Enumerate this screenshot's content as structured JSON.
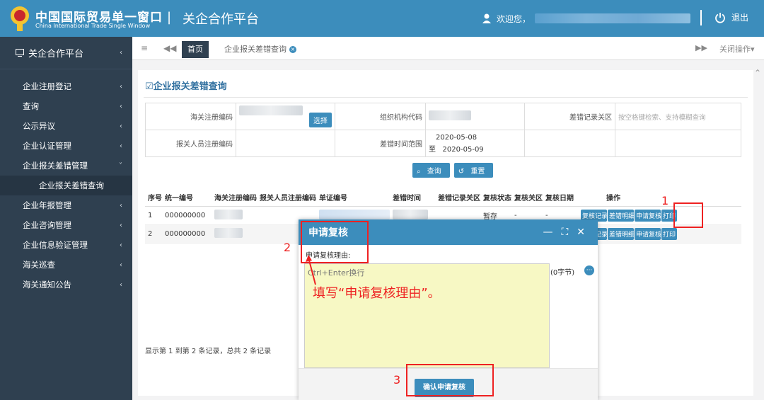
{
  "header": {
    "brand_cn": "中国国际贸易单一窗口",
    "brand_en": "China International Trade Single Window",
    "separator": "|",
    "platform": "关企合作平台",
    "welcome": "欢迎您，",
    "logout": "退出"
  },
  "sidebar": {
    "title": "关企合作平台",
    "items": [
      {
        "label": "企业注册登记",
        "chevron": "‹"
      },
      {
        "label": "查询",
        "chevron": "‹"
      },
      {
        "label": "公示异议",
        "chevron": "‹"
      },
      {
        "label": "企业认证管理",
        "chevron": "‹"
      },
      {
        "label": "企业报关差错管理",
        "chevron": "˅"
      }
    ],
    "sub_item": "企业报关差错查询",
    "items2": [
      {
        "label": "企业年报管理",
        "chevron": "‹"
      },
      {
        "label": "企业咨询管理",
        "chevron": "‹"
      },
      {
        "label": "企业信息验证管理",
        "chevron": "‹"
      },
      {
        "label": "海关巡查",
        "chevron": "‹"
      },
      {
        "label": "海关通知公告",
        "chevron": "‹"
      }
    ]
  },
  "tabs": {
    "home": "首页",
    "current": "企业报关差错查询",
    "close_ops": "关闭操作▾"
  },
  "page": {
    "title": "企业报关差错查询",
    "search": {
      "customs_code_label": "海关注册编码",
      "select_btn": "选择",
      "org_code_label": "组织机构代码",
      "error_customs_label": "差错记录关区",
      "error_customs_placeholder": "按空格键检索、支持模糊查询",
      "declarant_label": "报关人员注册编码",
      "time_range_label": "差错时间范围",
      "date_from": "2020-05-08",
      "date_to_prefix": "至",
      "date_to": "2020-05-09"
    },
    "query_btn": "查询",
    "reset_btn": "重置",
    "grid": {
      "headers": [
        "序号",
        "统一编号",
        "海关注册编码",
        "报关人员注册编码",
        "单证编号",
        "差错时间",
        "差错记录关区",
        "复核状态",
        "复核关区",
        "复核日期",
        "操作"
      ],
      "rows": [
        {
          "no": "1",
          "uid": "000000000",
          "status": "暂存",
          "dash1": "-",
          "dash2": "-"
        },
        {
          "no": "2",
          "uid": "000000000"
        }
      ],
      "ops": [
        "复核记录",
        "差错明细",
        "申请复核",
        "打印"
      ]
    },
    "footer": "显示第 1 到第 2 条记录，总共 2 条记录"
  },
  "modal": {
    "title": "申请复核",
    "ctrl_min": "—",
    "ctrl_max": "⛶",
    "ctrl_close": "✕",
    "reason_label": "申请复核理由:",
    "reason_placeholder": "Ctrl+Enter换行",
    "bytes": "(0字节)",
    "more": "···",
    "confirm": "确认申请复核"
  },
  "annotations": {
    "n1": "1",
    "n2": "2",
    "n3": "3",
    "hint": "填写“申请复核理由”。",
    "color": "#e22222"
  },
  "colors": {
    "primary": "#3c8dbc",
    "sidebar": "#2f4050",
    "textarea": "#f7f8c4"
  }
}
